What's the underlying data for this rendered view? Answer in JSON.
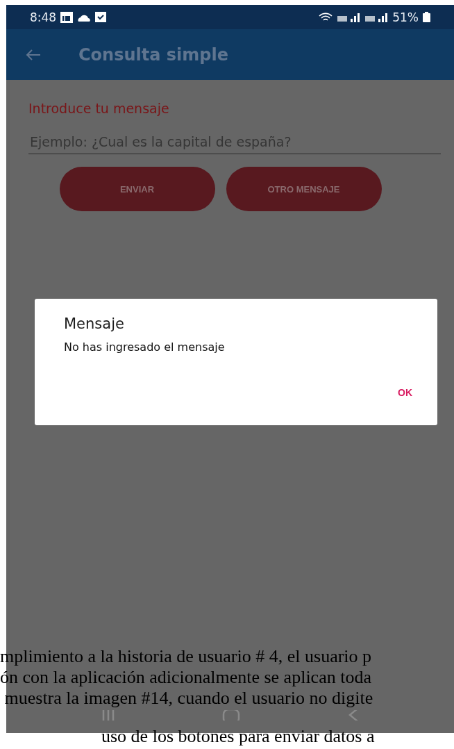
{
  "status_bar": {
    "time": "8:48",
    "battery": "51%"
  },
  "app_bar": {
    "title": "Consulta simple"
  },
  "form": {
    "label": "Introduce tu mensaje",
    "field": {
      "placeholder": "Ejemplo: ¿Cual es la capital de españa?"
    },
    "buttons": [
      "ENVIAR",
      "OTRO MENSAJE"
    ]
  },
  "dialog": {
    "title": "Mensaje",
    "message": "No has ingresado el mensaje",
    "button": "OK"
  },
  "document_text": [
    "mplimiento a la historia de usuario # 4, el usuario p",
    "ón con la aplicación adicionalmente se aplican toda",
    " muestra la imagen #14, cuando el usuario no digite",
    "uso de los botones para enviar datos a"
  ]
}
